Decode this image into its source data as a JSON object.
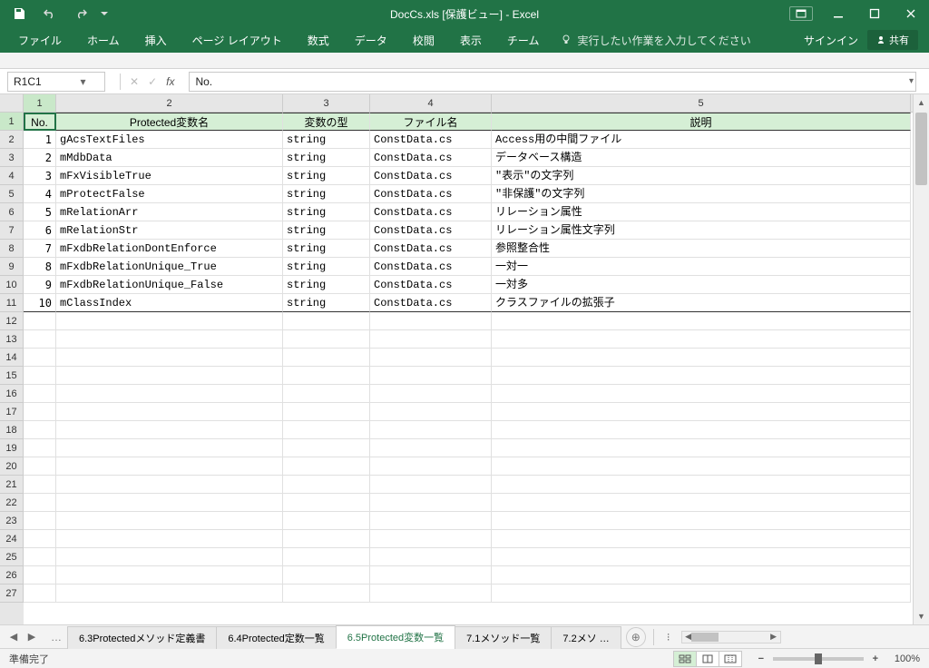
{
  "title": "DocCs.xls  [保護ビュー] - Excel",
  "qat": {
    "save": "保存",
    "undo": "元に戻す",
    "redo": "やり直し"
  },
  "ribbon": {
    "tabs": [
      "ファイル",
      "ホーム",
      "挿入",
      "ページ レイアウト",
      "数式",
      "データ",
      "校閲",
      "表示",
      "チーム"
    ],
    "tell_me": "実行したい作業を入力してください",
    "sign_in": "サインイン",
    "share": "共有"
  },
  "name_box": "R1C1",
  "formula": "No.",
  "col_nums": [
    "1",
    "2",
    "3",
    "4",
    "5"
  ],
  "col_widths": [
    "36",
    "250",
    "96",
    "134",
    "462"
  ],
  "headers": [
    "No.",
    "Protected変数名",
    "変数の型",
    "ファイル名",
    "説明"
  ],
  "rows": [
    {
      "n": "1",
      "name": "gAcsTextFiles",
      "type": "string",
      "file": "ConstData.cs",
      "desc": "Access用の中間ファイル"
    },
    {
      "n": "2",
      "name": "mMdbData",
      "type": "string",
      "file": "ConstData.cs",
      "desc": "データベース構造"
    },
    {
      "n": "3",
      "name": "mFxVisibleTrue",
      "type": "string",
      "file": "ConstData.cs",
      "desc": "\"表示\"の文字列"
    },
    {
      "n": "4",
      "name": "mProtectFalse",
      "type": "string",
      "file": "ConstData.cs",
      "desc": "\"非保護\"の文字列"
    },
    {
      "n": "5",
      "name": "mRelationArr",
      "type": "string",
      "file": "ConstData.cs",
      "desc": "リレーション属性"
    },
    {
      "n": "6",
      "name": "mRelationStr",
      "type": "string",
      "file": "ConstData.cs",
      "desc": "リレーション属性文字列"
    },
    {
      "n": "7",
      "name": "mFxdbRelationDontEnforce",
      "type": "string",
      "file": "ConstData.cs",
      "desc": "参照整合性"
    },
    {
      "n": "8",
      "name": "mFxdbRelationUnique_True",
      "type": "string",
      "file": "ConstData.cs",
      "desc": "一対一"
    },
    {
      "n": "9",
      "name": "mFxdbRelationUnique_False",
      "type": "string",
      "file": "ConstData.cs",
      "desc": "一対多"
    },
    {
      "n": "10",
      "name": "mClassIndex",
      "type": "string",
      "file": "ConstData.cs",
      "desc": "クラスファイルの拡張子"
    }
  ],
  "empty_rows": 16,
  "sheet_tabs": [
    "6.3Protectedメソッド定義書",
    "6.4Protected定数一覧",
    "6.5Protected変数一覧",
    "7.1メソッド一覧",
    "7.2メソ …"
  ],
  "active_tab": 2,
  "overflow_tab": "…",
  "status_text": "準備完了",
  "zoom": "100%"
}
